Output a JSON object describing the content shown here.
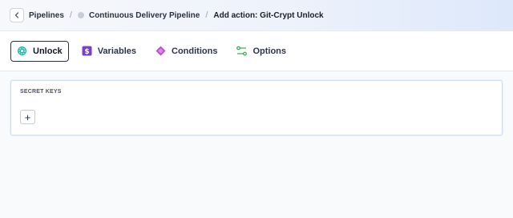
{
  "breadcrumb": {
    "items": [
      "Pipelines",
      "Continuous Delivery Pipeline",
      "Add action: Git-Crypt Unlock"
    ],
    "separator": "/"
  },
  "tabs": [
    {
      "label": "Unlock",
      "icon": "gear-icon",
      "active": true
    },
    {
      "label": "Variables",
      "icon": "dollar-icon",
      "active": false
    },
    {
      "label": "Conditions",
      "icon": "diamond-icon",
      "active": false
    },
    {
      "label": "Options",
      "icon": "options-icon",
      "active": false
    }
  ],
  "section": {
    "label": "SECRET KEYS",
    "add_label": "+"
  }
}
